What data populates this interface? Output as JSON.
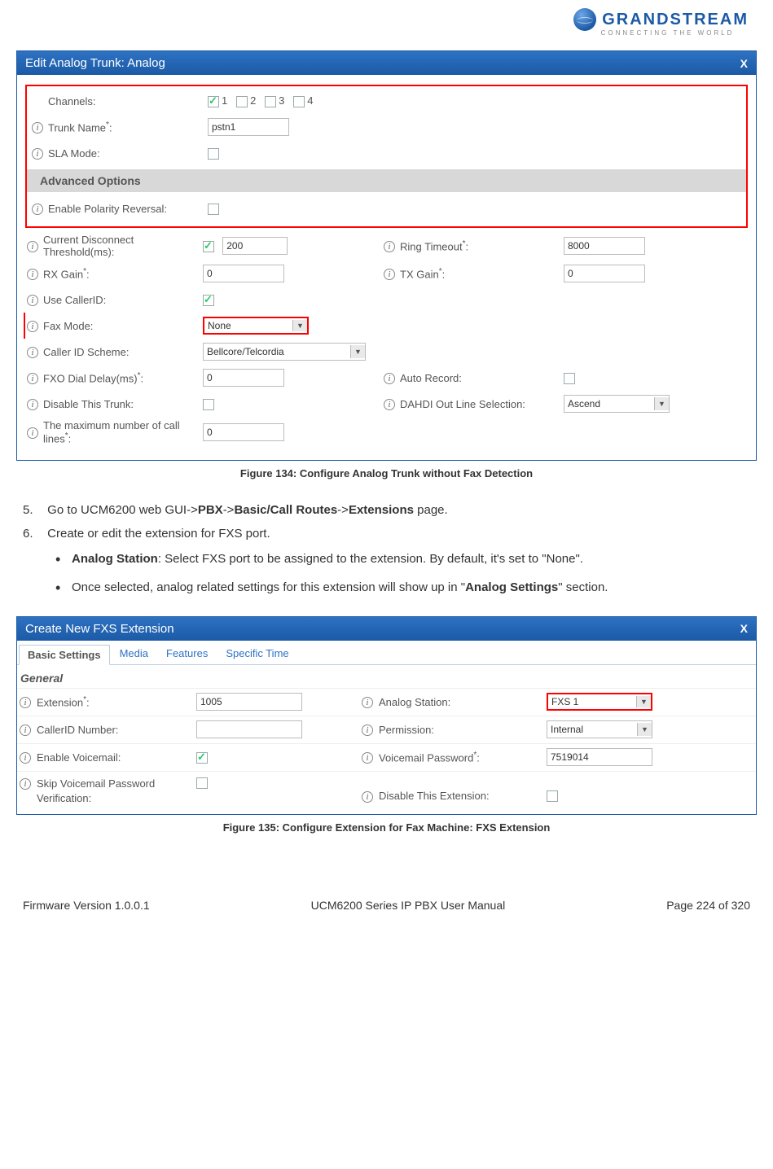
{
  "logo": {
    "brand": "GRANDSTREAM",
    "tagline": "CONNECTING THE WORLD"
  },
  "fig134": {
    "title": "Edit Analog Trunk: Analog",
    "close": "X",
    "channels_label": "Channels:",
    "channels": [
      "1",
      "2",
      "3",
      "4"
    ],
    "trunk_name_label": "Trunk Name",
    "trunk_name_value": "pstn1",
    "sla_label": "SLA Mode:",
    "adv_header": "Advanced Options",
    "polarity_label": "Enable Polarity Reversal:",
    "cdt_label": "Current Disconnect Threshold(ms):",
    "cdt_value": "200",
    "ring_timeout_label": "Ring Timeout",
    "ring_timeout_value": "8000",
    "rx_gain_label": "RX Gain",
    "rx_gain_value": "0",
    "tx_gain_label": "TX Gain",
    "tx_gain_value": "0",
    "use_callerid_label": "Use CallerID:",
    "fax_mode_label": "Fax Mode:",
    "fax_mode_value": "None",
    "cid_scheme_label": "Caller ID Scheme:",
    "cid_scheme_value": "Bellcore/Telcordia",
    "fxo_delay_label": "FXO Dial Delay(ms)",
    "fxo_delay_value": "0",
    "auto_record_label": "Auto Record:",
    "disable_trunk_label": "Disable This Trunk:",
    "dahdi_label": "DAHDI Out Line Selection:",
    "dahdi_value": "Ascend",
    "max_lines_label": "The maximum number of call lines",
    "max_lines_value": "0",
    "caption": "Figure 134: Configure Analog Trunk without Fax Detection"
  },
  "instructions": {
    "step5_num": "5.",
    "step5_a": "Go to UCM6200 web GUI->",
    "step5_b": "PBX",
    "step5_c": "->",
    "step5_d": "Basic/Call Routes",
    "step5_e": "->",
    "step5_f": "Extensions",
    "step5_g": " page.",
    "step6_num": "6.",
    "step6": "Create or edit the extension for FXS port.",
    "bullet1_a": "Analog Station",
    "bullet1_b": ": Select FXS port to be assigned to the extension. By default, it's set to \"None\".",
    "bullet2_a": "Once selected, analog related settings for this extension will show up in \"",
    "bullet2_b": "Analog Settings",
    "bullet2_c": "\" section."
  },
  "fig135": {
    "title": "Create New FXS Extension",
    "close": "X",
    "tabs": [
      "Basic Settings",
      "Media",
      "Features",
      "Specific Time"
    ],
    "general": "General",
    "ext_label": "Extension",
    "ext_value": "1005",
    "analog_station_label": "Analog Station:",
    "analog_station_value": "FXS 1",
    "cid_num_label": "CallerID Number:",
    "permission_label": "Permission:",
    "permission_value": "Internal",
    "enable_vm_label": "Enable Voicemail:",
    "vm_pw_label": "Voicemail Password",
    "vm_pw_value": "7519014",
    "skip_label": "Skip Voicemail Password Verification:",
    "disable_ext_label": "Disable This Extension:",
    "caption": "Figure 135: Configure Extension for Fax Machine: FXS Extension"
  },
  "footer": {
    "left": "Firmware Version 1.0.0.1",
    "center": "UCM6200 Series IP PBX User Manual",
    "right": "Page 224 of 320"
  }
}
